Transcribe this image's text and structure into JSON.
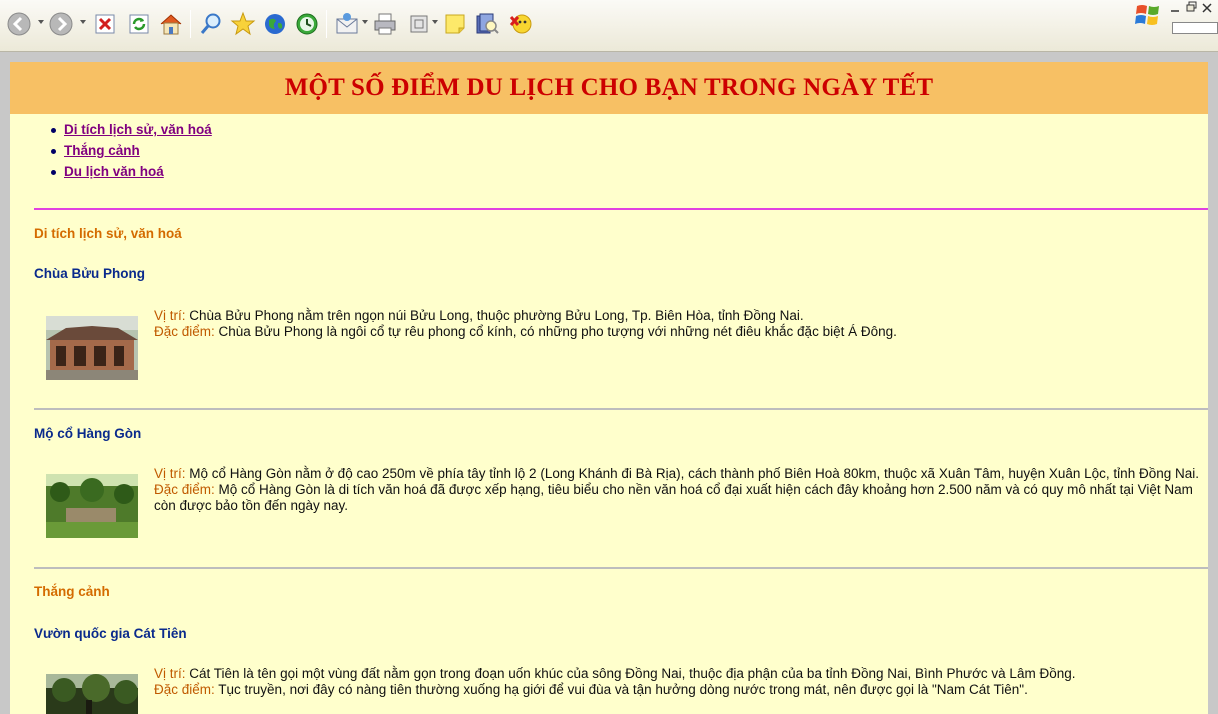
{
  "toolbar": {
    "buttons": [
      {
        "name": "back-icon"
      },
      {
        "name": "forward-icon"
      },
      {
        "name": "stop-icon"
      },
      {
        "name": "refresh-icon"
      },
      {
        "name": "home-icon"
      },
      {
        "name": "search-icon"
      },
      {
        "name": "favorites-star-icon"
      },
      {
        "name": "media-globe-icon"
      },
      {
        "name": "history-icon"
      },
      {
        "name": "mail-icon"
      },
      {
        "name": "print-icon"
      },
      {
        "name": "edit-icon"
      },
      {
        "name": "notes-icon"
      },
      {
        "name": "research-icon"
      },
      {
        "name": "messenger-icon"
      }
    ]
  },
  "page": {
    "title": "MỘT SỐ ĐIỂM DU LỊCH CHO BẠN TRONG NGÀY TẾT",
    "nav": [
      {
        "label": "Di tích lịch sử, văn hoá"
      },
      {
        "label": "Thắng cảnh"
      },
      {
        "label": "Du lịch văn hoá"
      }
    ],
    "sections": [
      {
        "title": "Di tích lịch sử, văn hoá",
        "items": [
          {
            "name": "Chùa Bửu Phong",
            "location_label": "Vị trí:",
            "location_text": " Chùa Bửu Phong nằm trên ngọn núi Bửu Long, thuộc phường Bửu Long, Tp. Biên Hòa, tỉnh Đồng Nai.",
            "feature_label": "Đặc điểm:",
            "feature_text": " Chùa Bửu Phong là ngôi cổ tự rêu phong cổ kính, có những pho tượng với những nét điêu khắc đặc biệt Á Đông."
          },
          {
            "name": "Mộ cổ Hàng Gòn",
            "location_label": "Vị trí:",
            "location_text": " Mộ cổ Hàng Gòn nằm ở độ cao 250m về phía tây tỉnh lộ 2 (Long Khánh đi Bà Rịa), cách thành phố Biên Hoà 80km, thuộc xã Xuân Tâm, huyện Xuân Lộc, tỉnh Đồng Nai.",
            "feature_label": "Đặc điểm:",
            "feature_text": " Mộ cổ Hàng Gòn là di tích văn hoá đã được xếp hạng, tiêu biểu cho nền văn hoá cổ đại xuất hiện cách đây khoảng hơn 2.500 năm và có quy mô nhất tại Việt Nam còn được bảo tồn đến ngày nay."
          }
        ]
      },
      {
        "title": "Thắng cảnh",
        "items": [
          {
            "name": "Vườn quốc gia Cát Tiên",
            "location_label": "Vị trí:",
            "location_text": " Cát Tiên là tên gọi một vùng đất nằm gọn trong đoạn uốn khúc của sông Đồng Nai, thuộc địa phận của ba tỉnh Đồng Nai, Bình Phước và Lâm Đồng.",
            "feature_label": "Đặc điểm:",
            "feature_text": " Tục truyền, nơi đây có nàng tiên thường xuống hạ giới để vui đùa và tận hưởng dòng nước trong mát, nên được gọi là \"Nam Cát Tiên\"."
          }
        ]
      }
    ]
  }
}
